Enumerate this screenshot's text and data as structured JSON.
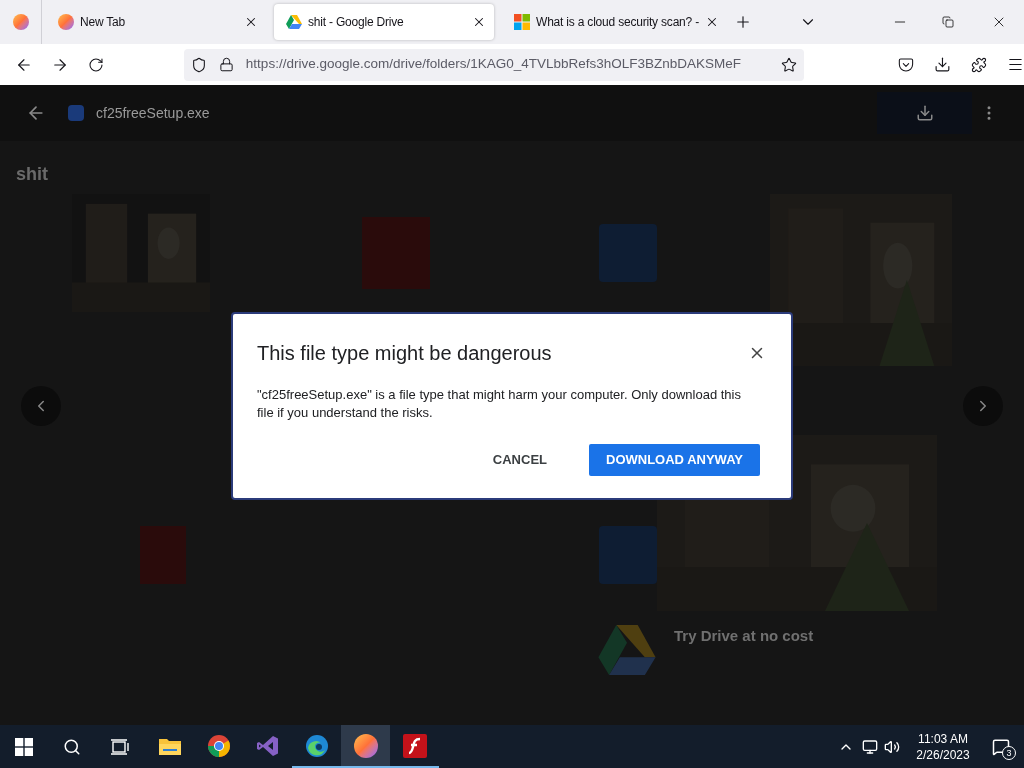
{
  "tabs": [
    {
      "title": "New Tab",
      "kind": "firefox",
      "selected": false
    },
    {
      "title": "shit - Google Drive",
      "kind": "drive",
      "selected": true
    },
    {
      "title": "What is a cloud security scan? -",
      "kind": "windows",
      "selected": false
    }
  ],
  "address_bar": {
    "url": "https://drive.google.com/drive/folders/1KAG0_4TVLbbRefs3hOLF3BZnbDAKSMeF"
  },
  "viewer": {
    "file_name": "cf25freeSetup.exe",
    "folder_title": "shit",
    "promo_title": "Try Drive at no cost"
  },
  "dialog": {
    "title": "This file type might be dangerous",
    "message": "\"cf25freeSetup.exe\" is a file type that might harm your computer. Only download this file if you understand the risks.",
    "cancel": "CANCEL",
    "confirm": "DOWNLOAD ANYWAY"
  },
  "taskbar": {
    "apps": [
      {
        "kind": "explorer",
        "running": false,
        "selected": false
      },
      {
        "kind": "chrome",
        "running": false,
        "selected": false
      },
      {
        "kind": "studio",
        "running": false,
        "selected": false
      },
      {
        "kind": "edge",
        "running": true,
        "selected": false
      },
      {
        "kind": "firefox",
        "running": true,
        "selected": true
      },
      {
        "kind": "flash",
        "running": true,
        "selected": false
      }
    ],
    "time": "11:03 AM",
    "date": "2/26/2023",
    "notification_count": "3"
  }
}
